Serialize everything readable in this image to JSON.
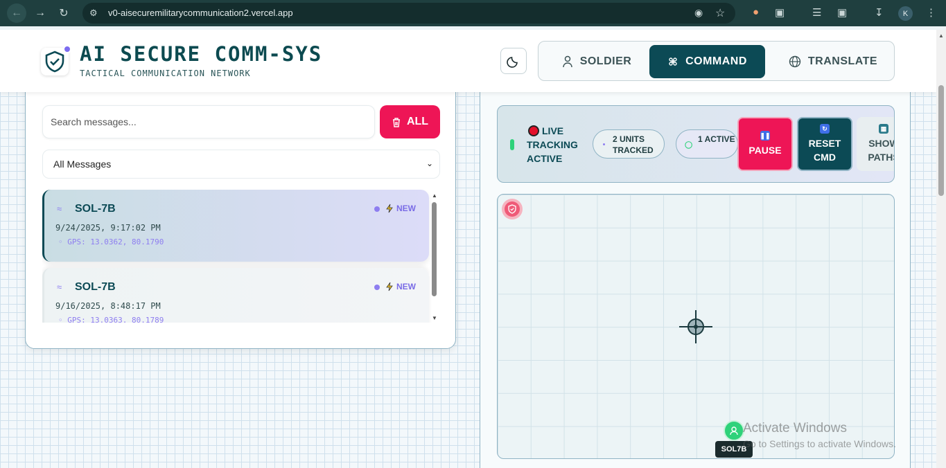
{
  "browser": {
    "url": "v0-aisecuremilitarycommunication2.vercel.app",
    "profile_initial": "K",
    "icons": [
      "back-icon",
      "forward-icon",
      "reload-icon",
      "site-settings-icon",
      "location-icon",
      "bookmark-star-icon",
      "extension-icon",
      "translate-icon",
      "download-icon",
      "menu-icon"
    ]
  },
  "header": {
    "title": "AI SECURE COMM-SYS",
    "subtitle": "TACTICAL COMMUNICATION NETWORK",
    "roles": [
      {
        "label": "SOLDIER",
        "icon": "user-icon",
        "active": false
      },
      {
        "label": "COMMAND",
        "icon": "command-icon",
        "active": true
      },
      {
        "label": "TRANSLATE",
        "icon": "globe-icon",
        "active": false
      }
    ]
  },
  "messages_panel": {
    "search_placeholder": "Search messages...",
    "clear_label": "ALL",
    "filter_value": "All Messages",
    "items": [
      {
        "unit": "SOL-7B",
        "badge": "NEW",
        "time": "9/24/2025, 9:17:02 PM",
        "gps": "GPS: 13.0362, 80.1790"
      },
      {
        "unit": "SOL-7B",
        "badge": "NEW",
        "time": "9/16/2025, 8:48:17 PM",
        "gps": "GPS: 13.0363, 80.1789"
      }
    ]
  },
  "tracking": {
    "status": "LIVE TRACKING ACTIVE",
    "units_tracked": "2 UNITS TRACKED",
    "active_count": "1 ACTIVE",
    "pause_label": "PAUSE",
    "reset_label": "RESET CMD",
    "paths_label": "SHOW PATHS",
    "soldier_label": "SOL7B"
  },
  "colors": {
    "primary": "#0c4a55",
    "danger": "#ee1556",
    "accent": "#8e7ef0",
    "live": "#2ed27a"
  },
  "watermark": {
    "line1": "Activate Windows",
    "line2": "Go to Settings to activate Windows."
  }
}
